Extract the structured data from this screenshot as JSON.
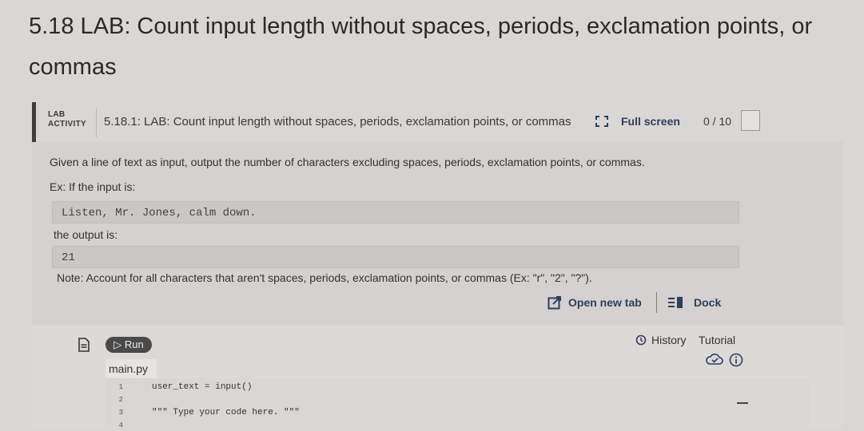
{
  "page": {
    "title": "5.18 LAB: Count input length without spaces, periods, exclamation points, or commas"
  },
  "lab_header": {
    "tag_line1": "LAB",
    "tag_line2": "ACTIVITY",
    "name": "5.18.1: LAB: Count input length without spaces, periods, exclamation points, or commas",
    "fullscreen_label": "Full screen",
    "score": "0 / 10"
  },
  "content": {
    "description": "Given a line of text as input, output the number of characters excluding spaces, periods, exclamation points, or commas.",
    "example_intro": "Ex: If the input is:",
    "example_input": "Listen, Mr. Jones, calm down.",
    "output_intro": "the output is:",
    "example_output": "21",
    "note": "Note: Account for all characters that aren't spaces, periods, exclamation points, or commas (Ex: \"r\", \"2\", \"?\")."
  },
  "actions": {
    "open_new_tab": "Open new tab",
    "dock": "Dock"
  },
  "editor": {
    "run_label": "▷ Run",
    "history_label": "History",
    "tutorial_label": "Tutorial",
    "file_name": "main.py",
    "lines": [
      {
        "num": "1",
        "text": "user_text = input()"
      },
      {
        "num": "2",
        "text": ""
      },
      {
        "num": "3",
        "text": "\"\"\" Type your code here. \"\"\""
      },
      {
        "num": "4",
        "text": ""
      }
    ]
  },
  "icons": {
    "fullscreen": "fullscreen-icon",
    "open_tab": "open-new-tab-icon",
    "dock": "dock-icon",
    "history": "history-icon",
    "cloud": "cloud-icon",
    "info": "info-icon",
    "file": "file-icon"
  },
  "colors": {
    "link": "#2c3f5e",
    "run_button": "#4a4a4a"
  }
}
